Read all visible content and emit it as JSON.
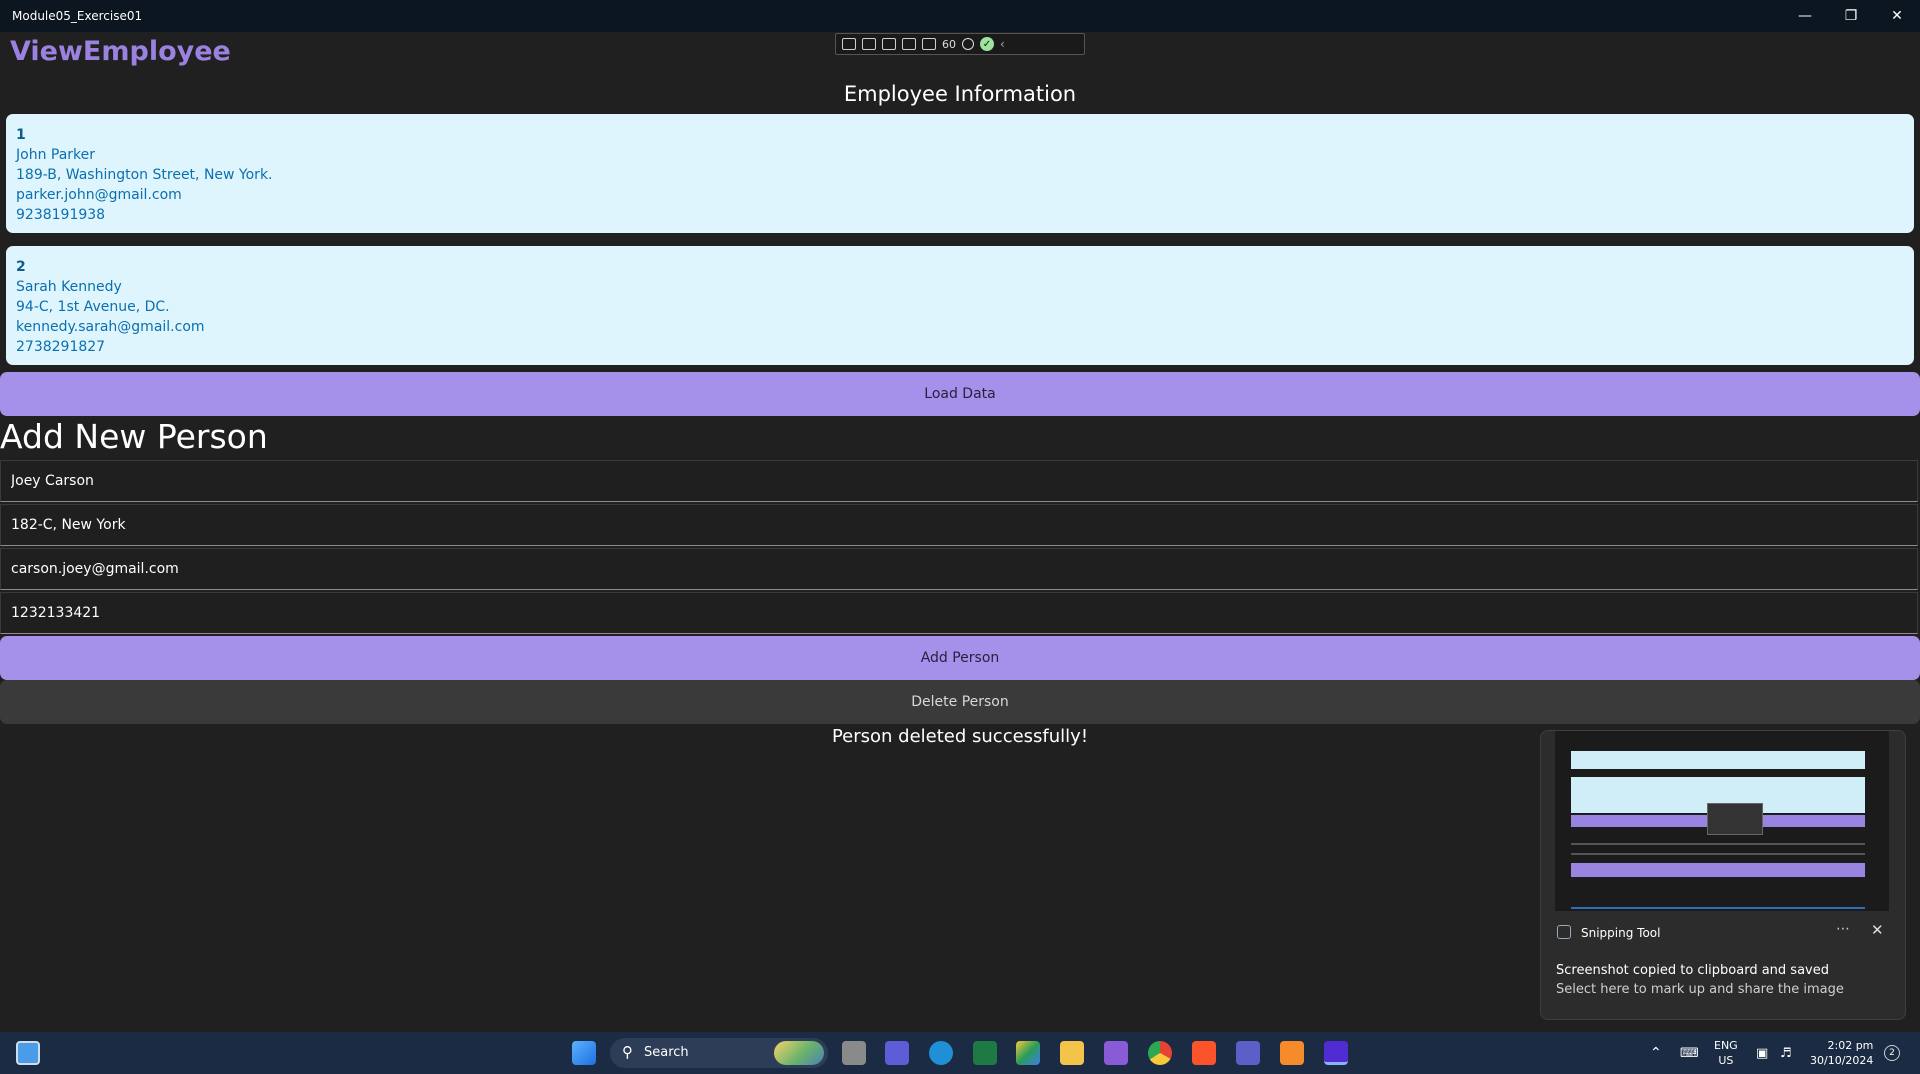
{
  "window": {
    "title": "Module05_Exercise01"
  },
  "devtools": {
    "fps": "60"
  },
  "app": {
    "page_title": "ViewEmployee",
    "section_title": "Employee Information",
    "employees": [
      {
        "id": "1",
        "name": "John Parker",
        "address": "189-B, Washington Street, New York.",
        "email": "parker.john@gmail.com",
        "phone": "9238191938"
      },
      {
        "id": "2",
        "name": "Sarah Kennedy",
        "address": "94-C, 1st Avenue, DC.",
        "email": "kennedy.sarah@gmail.com",
        "phone": "2738291827"
      }
    ],
    "load_button": "Load Data",
    "add_header": "Add New Person",
    "form": {
      "name": "Joey Carson",
      "address": "182-C, New York",
      "email": "carson.joey@gmail.com",
      "phone": "1232133421"
    },
    "add_button": "Add Person",
    "delete_button": "Delete Person",
    "status": "Person deleted successfully!",
    "accent_color": "#a590ea",
    "card_color": "#dff5fd"
  },
  "toast": {
    "app_name": "Snipping Tool",
    "title": "Screenshot copied to clipboard and saved",
    "body": "Select here to mark up and share the image"
  },
  "taskbar": {
    "search_label": "Search",
    "lang": "ENG",
    "region": "US",
    "time": "2:02 pm",
    "date": "30/10/2024",
    "notification_count": "2"
  }
}
